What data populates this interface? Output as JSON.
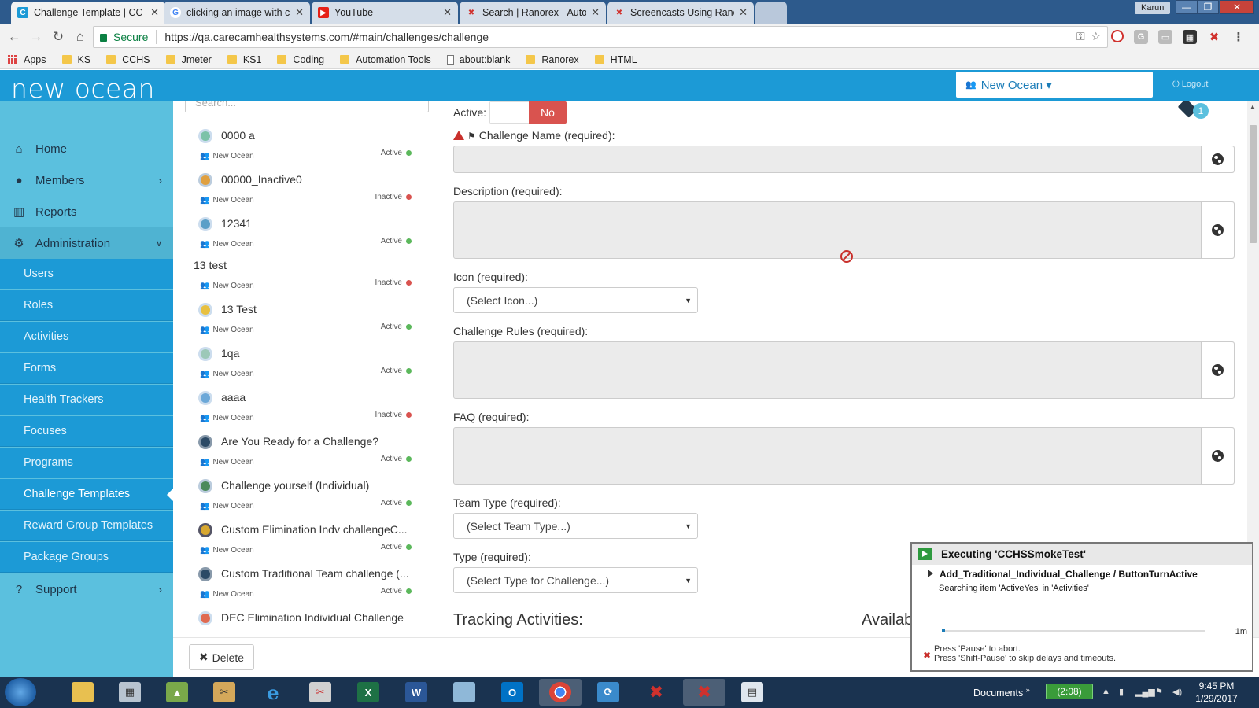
{
  "browser": {
    "tabs": [
      {
        "title": "Challenge Template | CC",
        "active": true
      },
      {
        "title": "clicking an image with c",
        "active": false
      },
      {
        "title": "YouTube",
        "active": false
      },
      {
        "title": "Search | Ranorex - Autom",
        "active": false
      },
      {
        "title": "Screencasts Using Ranor",
        "active": false
      }
    ],
    "user": "Karun",
    "secure_label": "Secure",
    "url": "https://qa.carecamhealthsystems.com/#main/challenges/challenge",
    "bookmarks": [
      "Apps",
      "KS",
      "CCHS",
      "Jmeter",
      "KS1",
      "Coding",
      "Automation Tools",
      "about:blank",
      "Ranorex",
      "HTML"
    ]
  },
  "header": {
    "logo": "new ocean",
    "org_select": "New Ocean ▾",
    "logout": "Logout"
  },
  "sidebar": {
    "items": [
      {
        "label": "Home",
        "icon": "home-icon"
      },
      {
        "label": "Members",
        "icon": "user-icon"
      },
      {
        "label": "Reports",
        "icon": "bar-chart-icon"
      },
      {
        "label": "Administration",
        "icon": "gear-icon"
      },
      {
        "label": "Support",
        "icon": "help-icon"
      }
    ],
    "admin_sub": [
      "Users",
      "Roles",
      "Activities",
      "Forms",
      "Health Trackers",
      "Focuses",
      "Programs",
      "Challenge Templates",
      "Reward Group Templates",
      "Package Groups"
    ],
    "active_sub": "Challenge Templates"
  },
  "list": {
    "search_placeholder": "Search...",
    "items": [
      {
        "name": "0000 a",
        "org": "New Ocean",
        "status": "Active"
      },
      {
        "name": "00000_Inactive0",
        "org": "New Ocean",
        "status": "Inactive"
      },
      {
        "name": "12341",
        "org": "New Ocean",
        "status": "Active"
      },
      {
        "name": "13 test",
        "org": "New Ocean",
        "status": "Inactive"
      },
      {
        "name": "13 Test",
        "org": "New Ocean",
        "status": "Active"
      },
      {
        "name": "1qa",
        "org": "New Ocean",
        "status": "Active"
      },
      {
        "name": "aaaa",
        "org": "New Ocean",
        "status": "Inactive"
      },
      {
        "name": "Are You Ready for a Challenge?",
        "org": "New Ocean",
        "status": "Active"
      },
      {
        "name": "Challenge yourself (Individual)",
        "org": "New Ocean",
        "status": "Active"
      },
      {
        "name": "Custom Elimination Indv challengeC...",
        "org": "New Ocean",
        "status": "Active"
      },
      {
        "name": "Custom Traditional Team challenge (...",
        "org": "New Ocean",
        "status": "Active"
      },
      {
        "name": "DEC Elimination Individual Challenge",
        "org": "",
        "status": ""
      }
    ],
    "delete_label": "Delete"
  },
  "form": {
    "active_label": "Active:",
    "active_toggle": "No",
    "badge_count": "1",
    "challenge_name_label": "Challenge Name (required):",
    "description_label": "Description (required):",
    "icon_label": "Icon (required):",
    "icon_select": "(Select Icon...)",
    "rules_label": "Challenge Rules (required):",
    "faq_label": "FAQ (required):",
    "team_type_label": "Team Type (required):",
    "team_type_select": "(Select Team Type...)",
    "type_label": "Type (required):",
    "type_select": "(Select Type for Challenge...)",
    "tracking_heading": "Tracking Activities:",
    "available_heading": "Availab"
  },
  "ranorex": {
    "title": "Executing 'CCHSSmokeTest'",
    "step": "Add_Traditional_Individual_Challenge / ButtonTurnActive",
    "message": "Searching item 'ActiveYes' in 'Activities'",
    "time": "1m",
    "progress": 0.01,
    "hint1": "Press 'Pause' to abort.",
    "hint2": "Press 'Shift-Pause' to skip delays and timeouts."
  },
  "taskbar": {
    "docs": "Documents",
    "battery": "(2:08)",
    "time": "9:45 PM",
    "date": "1/29/2017"
  },
  "colors": {
    "header_blue": "#1c9ad6",
    "sidebar_light": "#5bc0de",
    "active_dot": "#5cb85c",
    "inactive_dot": "#d9534f"
  }
}
